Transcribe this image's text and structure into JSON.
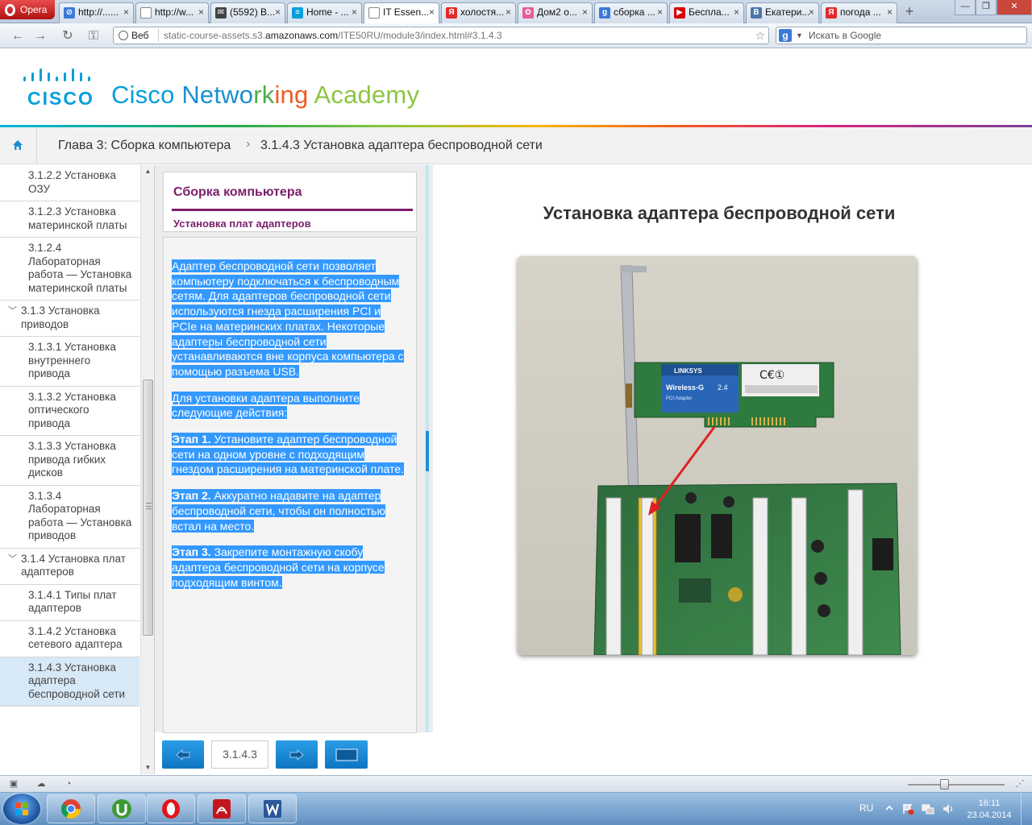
{
  "browser": {
    "menu_label": "Opera",
    "tabs": [
      {
        "label": "http://......",
        "icon": "opera-icon",
        "color": "#3c7ad8",
        "active": false
      },
      {
        "label": "http://w...",
        "icon": "page-icon",
        "color": "#888888",
        "active": false
      },
      {
        "label": "(5592) В...",
        "icon": "mail-icon",
        "color": "#444444",
        "active": false
      },
      {
        "label": "Home - ...",
        "icon": "cisco-icon",
        "color": "#049fd9",
        "active": false
      },
      {
        "label": "IT Essen...",
        "icon": "page-icon",
        "color": "#888888",
        "active": true
      },
      {
        "label": "холостя...",
        "icon": "yandex-icon",
        "color": "#e22b2b",
        "active": false
      },
      {
        "label": "Дом2 о...",
        "icon": "flower-icon",
        "color": "#e85c9a",
        "active": false
      },
      {
        "label": "сборка ...",
        "icon": "google-icon",
        "color": "#3c78d8",
        "active": false
      },
      {
        "label": "Беспла...",
        "icon": "youtube-icon",
        "color": "#d90000",
        "active": false
      },
      {
        "label": "Екатери...",
        "icon": "vk-icon",
        "color": "#4a76a8",
        "active": false
      },
      {
        "label": "погода ...",
        "icon": "yandex-icon",
        "color": "#e22b2b",
        "active": false
      }
    ],
    "address": {
      "web_label": "Веб",
      "url_prefix": "static-course-assets.s3.",
      "url_domain": "amazonaws.com",
      "url_suffix": "/ITE50RU/module3/index.html#3.1.4.3"
    },
    "search_placeholder": "Искать в Google"
  },
  "header": {
    "logo_word": "CISCO",
    "academy_words": [
      {
        "text": "Cisco ",
        "color": "#049fd9"
      },
      {
        "text": "Netwo",
        "color": "#1b8fd2"
      },
      {
        "text": "rk",
        "color": "#4cae4c"
      },
      {
        "text": "ing ",
        "color": "#f15a22"
      },
      {
        "text": "Academy",
        "color": "#8cc63f"
      }
    ]
  },
  "breadcrumb": {
    "chapter": "Глава 3: Сборка компьютера",
    "separator": "›",
    "current": "3.1.4.3 Установка адаптера беспроводной сети"
  },
  "sidebar": {
    "items": [
      {
        "label": "3.1.2.2 Установка ОЗУ",
        "level": 4,
        "active": false
      },
      {
        "label": "3.1.2.3 Установка материнской платы",
        "level": 4,
        "active": false
      },
      {
        "label": "3.1.2.4 Лабораторная работа — Установка материнской платы",
        "level": 4,
        "active": false
      },
      {
        "label": "3.1.3 Установка приводов",
        "level": 3,
        "active": false
      },
      {
        "label": "3.1.3.1 Установка внутреннего привода",
        "level": 4,
        "active": false
      },
      {
        "label": "3.1.3.2 Установка оптического привода",
        "level": 4,
        "active": false
      },
      {
        "label": "3.1.3.3 Установка привода гибких дисков",
        "level": 4,
        "active": false
      },
      {
        "label": "3.1.3.4 Лабораторная работа — Установка приводов",
        "level": 4,
        "active": false
      },
      {
        "label": "3.1.4 Установка плат адаптеров",
        "level": 3,
        "active": false
      },
      {
        "label": "3.1.4.1 Типы плат адаптеров",
        "level": 4,
        "active": false
      },
      {
        "label": "3.1.4.2 Установка сетевого адаптера",
        "level": 4,
        "active": false
      },
      {
        "label": "3.1.4.3 Установка адаптера беспроводной сети",
        "level": 4,
        "active": true
      }
    ]
  },
  "panel": {
    "title": "Сборка компьютера",
    "subtitle": "Установка плат адаптеров",
    "para1": "Адаптер беспроводной сети позволяет компьютеру подключаться к беспроводным сетям. Для адаптеров беспроводной сети используются гнезда расширения PCI и PCIe на материнских платах. Некоторые адаптеры беспроводной сети устанавливаются вне корпуса компьютера с помощью разъема USB.",
    "para2": "Для установки адаптера выполните следующие действия:",
    "steps": [
      {
        "label": "Этап 1.",
        "text": " Установите адаптер беспроводной сети на одном уровне с подходящим гнездом расширения на материнской плате."
      },
      {
        "label": "Этап 2.",
        "text": " Аккуратно надавите на адаптер беспроводной сети, чтобы он полностью встал на место."
      },
      {
        "label": "Этап 3.",
        "text": " Закрепите монтажную скобу адаптера беспроводной сети на корпусе подходящим винтом."
      }
    ]
  },
  "nav": {
    "page": "3.1.4.3"
  },
  "content": {
    "title": "Установка адаптера беспроводной сети",
    "card_brand": "LINKSYS",
    "card_model": "Wireless-G",
    "card_band": "2.4",
    "card_sub": "PCI Adapter",
    "card_marks": "C€①"
  },
  "taskbar": {
    "lang": "RU",
    "time": "16:11",
    "date": "23.04.2014"
  },
  "colors": {
    "accent_purple": "#7a1f6a",
    "accent_blue": "#1b8fd2",
    "selection": "#3399ff"
  }
}
